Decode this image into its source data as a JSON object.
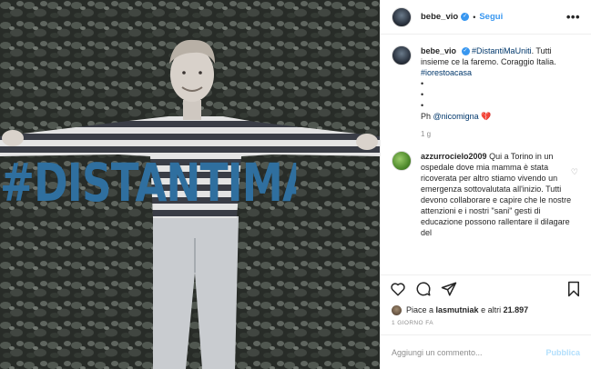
{
  "header": {
    "username": "bebe_vio",
    "separator": "•",
    "follow_label": "Segui",
    "more_icon": "•••"
  },
  "photo": {
    "overlay_text": "#DISTANTIMAUNITI",
    "overlay_color": "#2f6f9f"
  },
  "caption": {
    "username": "bebe_vio",
    "hashtag1": "#DistantiMaUniti",
    "text": ". Tutti insieme ce la faremo. Coraggio Italia.",
    "hashtag2": "#iorestoacasa",
    "bullets": [
      "•",
      "•",
      "•"
    ],
    "credit_prefix": "Ph",
    "credit_tag": "@nicomigna",
    "credit_emoji": "💔",
    "time": "1 g"
  },
  "comment": {
    "username": "azzurrocielo2009",
    "text": "Qui a Torino in un ospedale dove mia mamma è stata ricoverata per altro stiamo vivendo un emergenza sottovalutata all'inizio. Tutti devono collaborare e capire che le nostre attenzioni e i nostri \"sani\" gesti di educazione possono rallentare il dilagare del",
    "like_icon": "♡"
  },
  "likes": {
    "prefix": "Piace a",
    "user": "lasmutniak",
    "middle": "e altri",
    "count": "21.897"
  },
  "date_label": "1 GIORNO FA",
  "add_comment": {
    "placeholder": "Aggiungi un commento...",
    "publish_label": "Pubblica"
  },
  "colors": {
    "link_blue": "#3897f0",
    "tag_blue": "#00376b",
    "publish_disabled": "#b2dffc",
    "meta_gray": "#8e8e8e"
  }
}
